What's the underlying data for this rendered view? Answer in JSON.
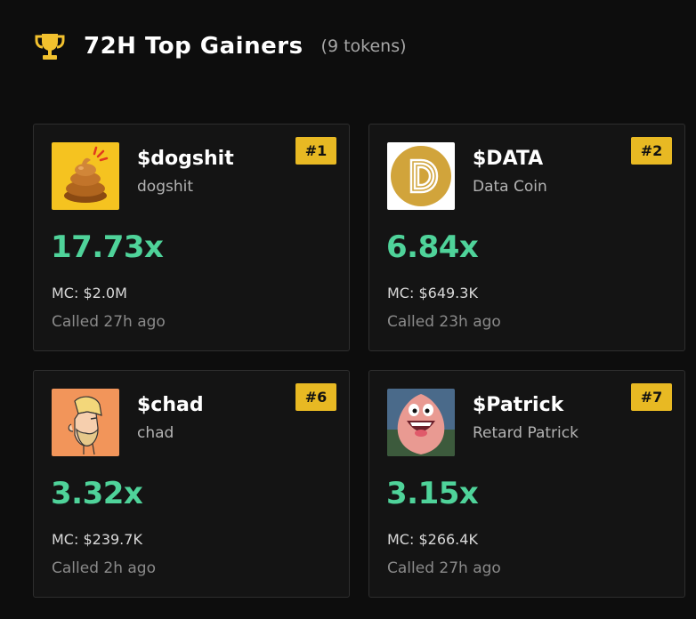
{
  "header": {
    "title": "72H Top Gainers",
    "count": "(9 tokens)",
    "icon": "trophy-icon",
    "icon_color": "#f2c12e"
  },
  "colors": {
    "multiplier": "#4fd39a",
    "rank_badge": "#e8b923",
    "card_bg": "#141414"
  },
  "tokens": [
    {
      "symbol": "$dogshit",
      "name": "dogshit",
      "rank": "#1",
      "multiplier": "17.73x",
      "mc": "MC: $2.0M",
      "called": "Called 27h ago",
      "icon": "poop-emoji-icon"
    },
    {
      "symbol": "$DATA",
      "name": "Data Coin",
      "rank": "#2",
      "multiplier": "6.84x",
      "mc": "MC: $649.3K",
      "called": "Called 23h ago",
      "icon": "data-coin-logo-icon"
    },
    {
      "symbol": "$chad",
      "name": "chad",
      "rank": "#6",
      "multiplier": "3.32x",
      "mc": "MC: $239.7K",
      "called": "Called 2h ago",
      "icon": "chad-face-icon"
    },
    {
      "symbol": "$Patrick",
      "name": "Retard Patrick",
      "rank": "#7",
      "multiplier": "3.15x",
      "mc": "MC: $266.4K",
      "called": "Called 27h ago",
      "icon": "patrick-starfish-icon"
    }
  ]
}
